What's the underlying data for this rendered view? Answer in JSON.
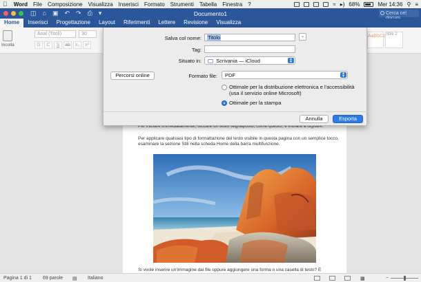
{
  "menubar": {
    "app_name": "Word",
    "items": [
      "File",
      "Composizione",
      "Visualizza",
      "Inserisci",
      "Formato",
      "Strumenti",
      "Tabella",
      "Finestra",
      "?"
    ],
    "battery": "68%",
    "clock": "Mer 14:36"
  },
  "titlebar": {
    "document_title": "Documento1",
    "search_placeholder": "Cerca nel docum"
  },
  "ribbon": {
    "tabs": [
      "Home",
      "Inserisci",
      "Progettazione",
      "Layout",
      "Riferimenti",
      "Lettere",
      "Revisione",
      "Visualizza"
    ],
    "active_tab": "Home",
    "paste_label": "Incolla",
    "font_name": "Arial (Titoli)",
    "font_size": "30",
    "style_sample": "AaBbCcDd",
    "style_sample2": "Stile 2"
  },
  "dialog": {
    "save_as_label": "Salva col nome:",
    "save_as_value": "Titolo",
    "tags_label": "Tag:",
    "tags_value": "",
    "location_label": "Situato in:",
    "location_value": "Scrivania — iCloud",
    "online_locations_button": "Percorsi online",
    "file_format_label": "Formato file:",
    "file_format_value": "PDF",
    "option_online_line1": "Ottimale per la distribuzione elettronica e l'accessibilità",
    "option_online_line2": "(usa il servizio online Microsoft)",
    "option_print": "Ottimale per la stampa",
    "selected_option": "print",
    "cancel_button": "Annulla",
    "export_button": "Esporta",
    "accent_color": "#2d7be8"
  },
  "document": {
    "paragraph1": "Per iniziare immediatamente, toccare un testo segnaposto, come questo, e iniziare a digitare.",
    "paragraph2": "Per applicare qualsiasi tipo di formattazione del testo visibile in questa pagina con un semplice tocco, esaminare la sezione Stili nella scheda Home della barra multifunzione.",
    "paragraph3": "Si vuole inserire un'immagine dai file oppure aggiungere una forma o una casella di testo? È"
  },
  "statusbar": {
    "page": "Pagina 1 di 1",
    "words": "69 parole",
    "language": "Italiano"
  },
  "colors": {
    "word_blue": "#2b579a",
    "ribbon_bg": "#f5f5f5"
  }
}
